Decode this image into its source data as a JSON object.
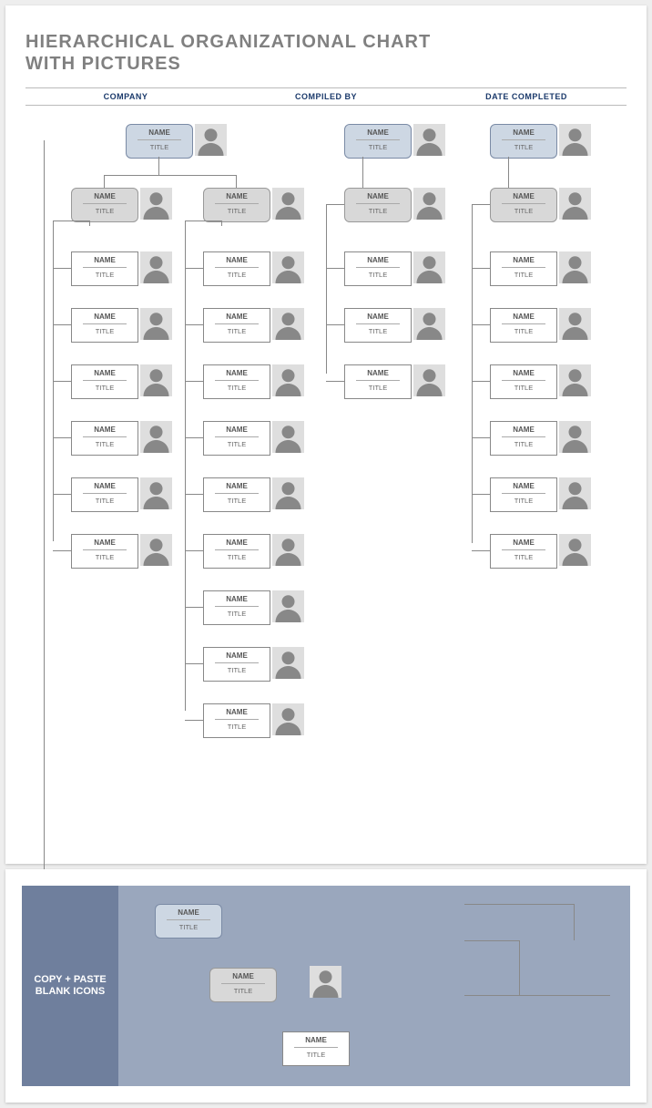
{
  "title_line1": "HIERARCHICAL ORGANIZATIONAL CHART",
  "title_line2": "WITH PICTURES",
  "headers": {
    "company": "COMPANY",
    "compiled": "COMPILED BY",
    "date": "DATE COMPLETED"
  },
  "labels": {
    "name": "NAME",
    "title": "TITLE"
  },
  "copy": "COPY + PASTE BLANK ICONS",
  "chart_data": {
    "type": "tree",
    "trees": [
      {
        "root_style": "blue",
        "root": {
          "name": "NAME",
          "title": "TITLE"
        },
        "branches": [
          {
            "style": "grey",
            "manager": {
              "name": "NAME",
              "title": "TITLE"
            },
            "reports": [
              {
                "name": "NAME",
                "title": "TITLE"
              },
              {
                "name": "NAME",
                "title": "TITLE"
              },
              {
                "name": "NAME",
                "title": "TITLE"
              },
              {
                "name": "NAME",
                "title": "TITLE"
              },
              {
                "name": "NAME",
                "title": "TITLE"
              },
              {
                "name": "NAME",
                "title": "TITLE"
              }
            ]
          },
          {
            "style": "grey",
            "manager": {
              "name": "NAME",
              "title": "TITLE"
            },
            "reports": [
              {
                "name": "NAME",
                "title": "TITLE"
              },
              {
                "name": "NAME",
                "title": "TITLE"
              },
              {
                "name": "NAME",
                "title": "TITLE"
              },
              {
                "name": "NAME",
                "title": "TITLE"
              },
              {
                "name": "NAME",
                "title": "TITLE"
              },
              {
                "name": "NAME",
                "title": "TITLE"
              },
              {
                "name": "NAME",
                "title": "TITLE"
              },
              {
                "name": "NAME",
                "title": "TITLE"
              },
              {
                "name": "NAME",
                "title": "TITLE"
              }
            ]
          }
        ]
      },
      {
        "root_style": "blue",
        "root": {
          "name": "NAME",
          "title": "TITLE"
        },
        "branches": [
          {
            "style": "grey",
            "manager": {
              "name": "NAME",
              "title": "TITLE"
            },
            "reports": [
              {
                "name": "NAME",
                "title": "TITLE"
              },
              {
                "name": "NAME",
                "title": "TITLE"
              },
              {
                "name": "NAME",
                "title": "TITLE"
              }
            ]
          }
        ]
      },
      {
        "root_style": "blue",
        "root": {
          "name": "NAME",
          "title": "TITLE"
        },
        "branches": [
          {
            "style": "grey",
            "manager": {
              "name": "NAME",
              "title": "TITLE"
            },
            "reports": [
              {
                "name": "NAME",
                "title": "TITLE"
              },
              {
                "name": "NAME",
                "title": "TITLE"
              },
              {
                "name": "NAME",
                "title": "TITLE"
              },
              {
                "name": "NAME",
                "title": "TITLE"
              },
              {
                "name": "NAME",
                "title": "TITLE"
              },
              {
                "name": "NAME",
                "title": "TITLE"
              }
            ]
          }
        ]
      }
    ],
    "palette_samples": [
      {
        "style": "blue",
        "name": "NAME",
        "title": "TITLE"
      },
      {
        "style": "grey",
        "name": "NAME",
        "title": "TITLE"
      },
      {
        "style": "white",
        "name": "NAME",
        "title": "TITLE"
      }
    ]
  }
}
